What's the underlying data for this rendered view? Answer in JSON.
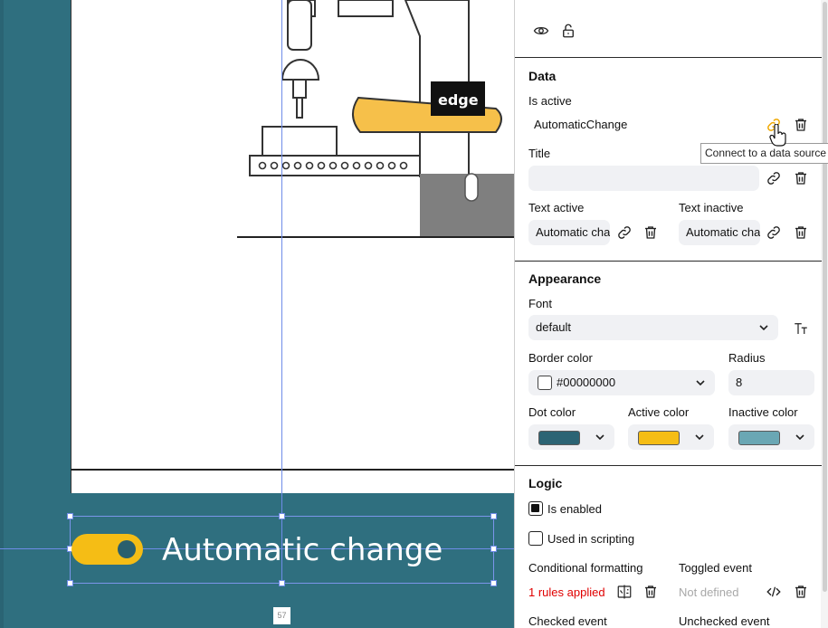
{
  "canvas": {
    "illustration_logo_text": "edge",
    "toggle_label": "Automatic change",
    "size_badge": "57",
    "colors": {
      "background": "#2f6f7f",
      "toggle_active": "#f5bd15",
      "toggle_dot": "#2a5f6d"
    }
  },
  "panel": {
    "top_icons": {
      "visibility": "eye-icon",
      "lock": "unlock-icon"
    },
    "data": {
      "title": "Data",
      "is_active": {
        "label": "Is active",
        "value": "AutomaticChange",
        "link_icon": "link-icon",
        "delete_icon": "trash-icon"
      },
      "tooltip": "Connect to a data source",
      "title_field": {
        "label": "Title",
        "value": ""
      },
      "text_active": {
        "label": "Text active",
        "value": "Automatic change"
      },
      "text_inactive": {
        "label": "Text inactive",
        "value": "Automatic change"
      }
    },
    "appearance": {
      "title": "Appearance",
      "font": {
        "label": "Font",
        "value": "default",
        "icon": "text-size-icon"
      },
      "border_color": {
        "label": "Border color",
        "value": "#00000000"
      },
      "radius": {
        "label": "Radius",
        "value": "8"
      },
      "dot_color": {
        "label": "Dot color",
        "swatch": "#2c6474"
      },
      "active_color": {
        "label": "Active color",
        "swatch": "#f5bd15"
      },
      "inactive_color": {
        "label": "Inactive color",
        "swatch": "#6aa7b4"
      }
    },
    "logic": {
      "title": "Logic",
      "is_enabled": {
        "label": "Is enabled",
        "checked": true
      },
      "used_in_scripting": {
        "label": "Used in scripting",
        "checked": false
      },
      "conditional_formatting": {
        "label": "Conditional formatting",
        "value": "1 rules applied",
        "value_color": "#e00000"
      },
      "toggled_event": {
        "label": "Toggled event",
        "value": "Not defined"
      },
      "checked_event": {
        "label": "Checked event"
      },
      "unchecked_event": {
        "label": "Unchecked event"
      }
    }
  }
}
